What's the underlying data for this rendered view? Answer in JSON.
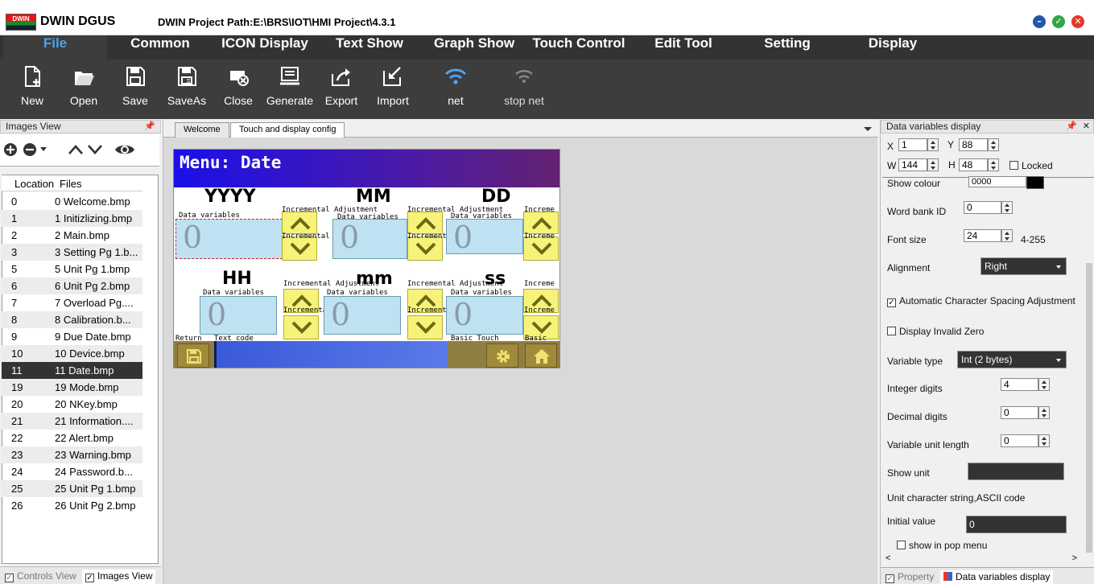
{
  "window": {
    "logo_text": "DWIN",
    "brand": "DWIN DGUS",
    "path": "DWIN Project Path:E:\\BRS\\IOT\\HMI Project\\4.3.1"
  },
  "menu": [
    "File",
    "Common",
    "ICON Display",
    "Text Show",
    "Graph Show",
    "Touch Control",
    "Edit Tool",
    "Setting",
    "Display"
  ],
  "toolbar": {
    "new": "New",
    "open": "Open",
    "save": "Save",
    "saveas": "SaveAs",
    "close": "Close",
    "generate": "Generate",
    "export": "Export",
    "import": "Import",
    "net": "net",
    "stopnet": "stop net"
  },
  "left": {
    "title": "Images View",
    "col_location": "Location",
    "col_files": "Files",
    "rows": [
      [
        "0",
        "0 Welcome.bmp"
      ],
      [
        "1",
        "1 Initizlizing.bmp"
      ],
      [
        "2",
        "2 Main.bmp"
      ],
      [
        "3",
        "3 Setting Pg 1.b..."
      ],
      [
        "5",
        "5 Unit Pg 1.bmp"
      ],
      [
        "6",
        "6 Unit Pg 2.bmp"
      ],
      [
        "7",
        "7 Overload Pg...."
      ],
      [
        "8",
        "8 Calibration.b..."
      ],
      [
        "9",
        "9 Due Date.bmp"
      ],
      [
        "10",
        "10 Device.bmp"
      ],
      [
        "11",
        "11 Date.bmp"
      ],
      [
        "19",
        "19 Mode.bmp"
      ],
      [
        "20",
        "20 NKey.bmp"
      ],
      [
        "21",
        "21 Information...."
      ],
      [
        "22",
        "22 Alert.bmp"
      ],
      [
        "23",
        "23 Warning.bmp"
      ],
      [
        "24",
        "24 Password.b..."
      ],
      [
        "25",
        "25 Unit Pg 1.bmp"
      ],
      [
        "26",
        "26 Unit Pg 2.bmp"
      ]
    ],
    "selected_index": 10,
    "tab_controls": "Controls View",
    "tab_images": "Images View"
  },
  "doc": {
    "tab_welcome": "Welcome",
    "tab_config": "Touch and display config",
    "canvas": {
      "header": "Menu: Date",
      "yyyy": "YYYY",
      "mm_up": "MM",
      "dd": "DD",
      "hh": "HH",
      "mm_low": "mm",
      "ss": "ss",
      "zero": "0",
      "lbl_dv": "Data variables",
      "lbl_inc": "Incremental Adjustment",
      "lbl_inc2": "Increme",
      "lbl_return": "Return",
      "lbl_basic": "Basic",
      "lbl_textcode": "Text code",
      "lbl_basic_touch": "Basic Touch"
    }
  },
  "right": {
    "title": "Data variables display",
    "x_label": "X",
    "x": "1",
    "y_label": "Y",
    "y": "88",
    "w_label": "W",
    "w": "144",
    "h_label": "H",
    "h": "48",
    "locked": "Locked",
    "show_colour": "Show colour",
    "colour_val": "0000",
    "word_bank_id": "Word bank ID",
    "word_bank_val": "0",
    "font_size": "Font size",
    "font_size_val": "24",
    "font_range": "4-255",
    "alignment": "Alignment",
    "alignment_val": "Right",
    "auto_spacing": "Automatic Character Spacing Adjustment",
    "invalid_zero": "Display Invalid Zero",
    "variable_type": "Variable type",
    "variable_type_val": "Int (2 bytes)",
    "integer_digits": "Integer digits",
    "integer_digits_val": "4",
    "decimal_digits": "Decimal digits",
    "decimal_digits_val": "0",
    "unit_length": "Variable unit length",
    "unit_length_val": "0",
    "show_unit": "Show unit",
    "unit_string": "Unit character string,ASCII code",
    "initial_value": "Initial value",
    "initial_value_val": "0",
    "pop_menu": "show in pop menu",
    "tab_property": "Property",
    "tab_dv": "Data variables display"
  },
  "colors": {
    "accent": "#4aa3f0",
    "menubar": "#333333",
    "toolbar": "#3d3d3d",
    "selected_row": "#333333",
    "header_blue": "#1a10e8"
  }
}
